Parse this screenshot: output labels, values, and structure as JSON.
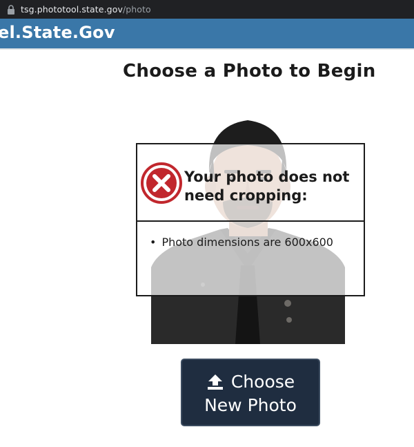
{
  "browser": {
    "url_host": "tsg.phototool.state.gov",
    "url_path": "/photo"
  },
  "header": {
    "brand": "el.State.Gov"
  },
  "main": {
    "title": "Choose a Photo to Begin"
  },
  "result_card": {
    "heading": "Your photo does not need cropping:",
    "status_icon": "error-x-icon",
    "status_color": "#c1272d",
    "details": [
      "Photo dimensions are 600x600"
    ]
  },
  "actions": {
    "choose_line1": "Choose",
    "choose_line2": "New Photo",
    "button_color": "#1f2d40"
  }
}
